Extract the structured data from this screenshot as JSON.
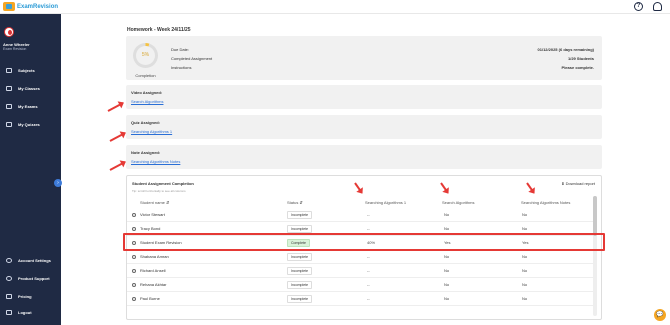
{
  "app": {
    "brand": "ExamRevision"
  },
  "header": {
    "help_icon": "?",
    "profile_icon": "person"
  },
  "sidebar": {
    "user_name": "Anne Wheeler",
    "user_role": "Exam Revision",
    "items": [
      {
        "label": "Subjects",
        "icon": "monitor-icon"
      },
      {
        "label": "My Classes",
        "icon": "users-icon"
      },
      {
        "label": "My Exams",
        "icon": "book-icon"
      },
      {
        "label": "My Quizzes",
        "icon": "clipboard-icon"
      },
      {
        "label": "Account Settings",
        "icon": "gear-icon"
      },
      {
        "label": "Product Support",
        "icon": "globe-icon"
      },
      {
        "label": "Pricing",
        "icon": "card-icon"
      },
      {
        "label": "Logout",
        "icon": "logout-icon"
      }
    ],
    "collapse": "›"
  },
  "homework": {
    "title": "Homework - Week 24/11/25",
    "progress_fraction": 0.05,
    "progress_text": "5%",
    "progress_label": "Completion",
    "due_label": "Due Date:",
    "due_value": "01/12/2025 (6 days remaining)",
    "completed_label": "Completed Assignment",
    "completed_value": "1/29 Students",
    "instructions_label": "Instructions",
    "instructions_value": "Please complete."
  },
  "assignments": [
    {
      "title": "Video Assigned:",
      "link": "Search Algorithms"
    },
    {
      "title": "Quiz Assigned:",
      "link": "Searching Algorithms 1"
    },
    {
      "title": "Note Assigned:",
      "link": "Searching Algorithms Notes"
    }
  ],
  "completion_table": {
    "title": "Student Assignment Completion",
    "hint": "Tip: scroll horizontally to see all columns",
    "download": "⬇ Download report",
    "columns": [
      "Student name ⇵",
      "Status ⇵",
      "Searching Algorithms 1",
      "Search Algorithms",
      "Searching Algorithms Notes"
    ],
    "rows": [
      {
        "name": "Victor Stewart",
        "status": "Incomplete",
        "quiz": "--",
        "video": "No",
        "notes": "No"
      },
      {
        "name": "Tracy Bond",
        "status": "Incomplete",
        "quiz": "--",
        "video": "No",
        "notes": "No"
      },
      {
        "name": "Student Exam Revision",
        "status": "Complete",
        "quiz": "40%",
        "video": "Yes",
        "notes": "Yes"
      },
      {
        "name": "Shabana Amran",
        "status": "Incomplete",
        "quiz": "--",
        "video": "No",
        "notes": "No"
      },
      {
        "name": "Richard Ansell",
        "status": "Incomplete",
        "quiz": "--",
        "video": "No",
        "notes": "No"
      },
      {
        "name": "Rehana Akhtar",
        "status": "Incomplete",
        "quiz": "--",
        "video": "No",
        "notes": "No"
      },
      {
        "name": "Paul Burne",
        "status": "Incomplete",
        "quiz": "--",
        "video": "No",
        "notes": "No"
      }
    ]
  },
  "chat_icon": "💬",
  "colors": {
    "sidebar": "#1f2a44",
    "accent": "#f5a623",
    "link": "#2a6fd6",
    "annotation": "#e53935"
  }
}
